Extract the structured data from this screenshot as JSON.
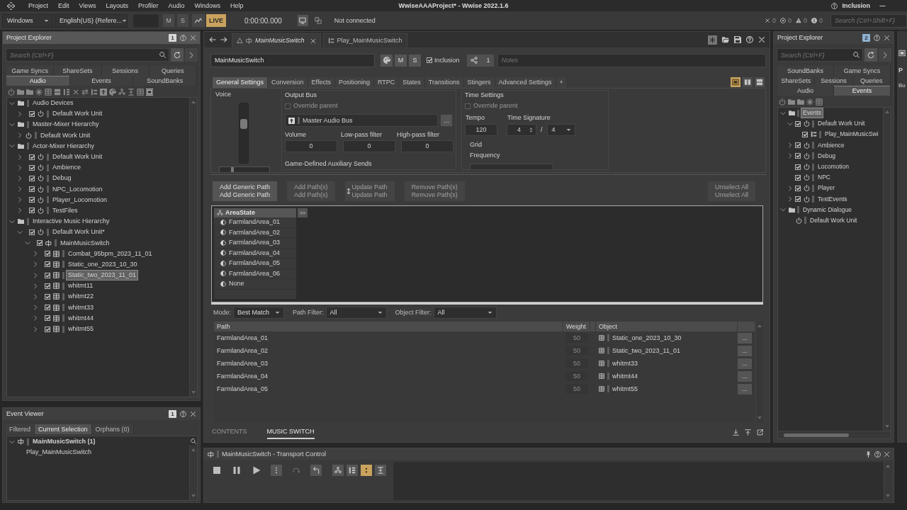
{
  "title_bar": {
    "menu": [
      "Project",
      "Edit",
      "Views",
      "Layouts",
      "Profiler",
      "Audio",
      "Windows",
      "Help"
    ],
    "title": "WwiseAAAProject* - Wwise 2022.1.6",
    "layout": "Inclusion"
  },
  "toolbar": {
    "layout_dropdown": "Windows",
    "language_dropdown": "English(US) (Refere...",
    "mute": "M",
    "solo": "S",
    "live": {
      "label": "LIVE",
      "on": true
    },
    "time": "0:00:00.000",
    "connection": "Not connected",
    "counters": [
      {
        "kind": "error",
        "count": "0"
      },
      {
        "kind": "critical",
        "count": "0"
      },
      {
        "kind": "warning",
        "count": "0"
      },
      {
        "kind": "info",
        "count": "0"
      }
    ],
    "search": {
      "placeholder": "Search (Ctrl+Shift+F)"
    }
  },
  "project_explorer": {
    "title": "Project Explorer",
    "badge": "1",
    "search": {
      "placeholder": "Search (Ctrl+F)"
    },
    "tab_rows": [
      [
        {
          "label": "Game Syncs",
          "selected": false
        },
        {
          "label": "ShareSets",
          "selected": false
        },
        {
          "label": "Sessions",
          "selected": false
        },
        {
          "label": "Queries",
          "selected": false
        }
      ],
      [
        {
          "label": "Audio",
          "selected": true
        },
        {
          "label": "Events",
          "selected": false
        },
        {
          "label": "SoundBanks",
          "selected": false
        }
      ]
    ],
    "toolbar": [
      {
        "on": false
      },
      {
        "on": false
      },
      {
        "on": false
      },
      {
        "on": false
      },
      {
        "on": false
      },
      {
        "on": false
      },
      {
        "on": false
      },
      {
        "on": false
      },
      {
        "on": false
      },
      {
        "on": false
      },
      {
        "on": false
      },
      {
        "on": false
      },
      {
        "on": false
      },
      {
        "on": false
      },
      {
        "on": false
      },
      {
        "on": true
      }
    ],
    "tree": [
      {
        "label": "Audio Devices",
        "kind": "folder",
        "expanded": true,
        "selected": false,
        "children": [
          {
            "label": "Default Work Unit",
            "kind": "work_unit",
            "expanded": false,
            "checked": true,
            "selected": false
          }
        ]
      },
      {
        "label": "Master-Mixer Hierarchy",
        "kind": "folder",
        "expanded": true,
        "selected": false,
        "children": [
          {
            "label": "Default Work Unit",
            "kind": "work_unit",
            "expanded": false,
            "selected": false
          }
        ]
      },
      {
        "label": "Actor-Mixer Hierarchy",
        "kind": "folder",
        "expanded": true,
        "selected": false,
        "children": [
          {
            "label": "Default Work Unit",
            "kind": "work_unit",
            "expanded": false,
            "checked": true,
            "selected": false
          },
          {
            "label": "Ambience",
            "kind": "work_unit",
            "expanded": false,
            "checked": true,
            "selected": false
          },
          {
            "label": "Debug",
            "kind": "work_unit",
            "expanded": false,
            "checked": true,
            "selected": false
          },
          {
            "label": "NPC_Locomotion",
            "kind": "work_unit",
            "expanded": false,
            "checked": true,
            "selected": false
          },
          {
            "label": "Player_Locomotion",
            "kind": "work_unit",
            "expanded": false,
            "checked": true,
            "selected": false
          },
          {
            "label": "TestFiles",
            "kind": "work_unit",
            "expanded": false,
            "checked": true,
            "selected": false
          }
        ]
      },
      {
        "label": "Interactive Music Hierarchy",
        "kind": "folder",
        "expanded": true,
        "selected": false,
        "children": [
          {
            "label": "Default Work Unit*",
            "kind": "work_unit",
            "expanded": true,
            "checked": true,
            "selected": false,
            "children": [
              {
                "label": "MainMusicSwitch",
                "kind": "switch",
                "expanded": true,
                "checked": true,
                "selected": false,
                "children": [
                  {
                    "label": "Combat_95bpm_2023_11_01",
                    "kind": "segment",
                    "expanded": false,
                    "checked": true,
                    "selected": false
                  },
                  {
                    "label": "Static_one_2023_10_30",
                    "kind": "segment",
                    "expanded": false,
                    "checked": true,
                    "selected": false
                  },
                  {
                    "label": "Static_two_2023_11_01",
                    "kind": "segment",
                    "expanded": false,
                    "checked": true,
                    "selected": true
                  },
                  {
                    "label": "whitmt11",
                    "kind": "segment",
                    "expanded": false,
                    "checked": true,
                    "selected": false
                  },
                  {
                    "label": "whitmt22",
                    "kind": "segment",
                    "expanded": false,
                    "checked": true,
                    "selected": false
                  },
                  {
                    "label": "whitmt33",
                    "kind": "segment",
                    "expanded": false,
                    "checked": true,
                    "selected": false
                  },
                  {
                    "label": "whitmt44",
                    "kind": "segment",
                    "expanded": false,
                    "checked": true,
                    "selected": false
                  },
                  {
                    "label": "whitmt55",
                    "kind": "segment",
                    "expanded": false,
                    "checked": true,
                    "selected": false
                  }
                ]
              }
            ]
          }
        ]
      }
    ]
  },
  "event_viewer": {
    "title": "Event Viewer",
    "badge": "1",
    "tabs": [
      {
        "label": "Filtered",
        "selected": false
      },
      {
        "label": "Current Selection",
        "selected": true
      },
      {
        "label": "Orphans (0)",
        "selected": false
      }
    ],
    "tree": [
      {
        "label": "MainMusicSwitch (1)",
        "kind": "switch",
        "expanded": true,
        "selected": false,
        "children": [
          {
            "label": "Play_MainMusicSwitch",
            "selected": false
          }
        ]
      }
    ]
  },
  "editor": {
    "doc_tabs": [
      {
        "label": "MainMusicSwitch",
        "kind": "switch",
        "selected": true
      },
      {
        "label": "Play_MainMusicSwitch",
        "kind": "event",
        "selected": false
      }
    ],
    "name": "MainMusicSwitch",
    "mute": "M",
    "solo": "S",
    "inclusion": {
      "label": "Inclusion",
      "checked": true
    },
    "references": "1",
    "notes": {
      "placeholder": "Notes"
    },
    "property_tabs": [
      {
        "label": "General Settings",
        "selected": true
      },
      {
        "label": "Conversion",
        "selected": false
      },
      {
        "label": "Effects",
        "selected": false
      },
      {
        "label": "Positioning",
        "selected": false
      },
      {
        "label": "RTPC",
        "selected": false
      },
      {
        "label": "States",
        "selected": false
      },
      {
        "label": "Transitions",
        "selected": false
      },
      {
        "label": "Stingers",
        "selected": false
      },
      {
        "label": "Advanced Settings",
        "selected": false
      }
    ],
    "add_tab": "+",
    "layout_buttons": [
      {
        "kind": "single",
        "selected": true
      },
      {
        "kind": "columns",
        "selected": false
      },
      {
        "kind": "rows",
        "selected": false
      }
    ],
    "voice": {
      "label": "Voice",
      "vertical_slider": {
        "level": 0.65
      },
      "horizontal_slider": {
        "level": 0.25
      }
    },
    "output_bus": {
      "title": "Output Bus",
      "override": {
        "label": "Override parent",
        "checked": false,
        "disabled": true
      },
      "bus": "Master Audio Bus",
      "browse": "...",
      "fields": [
        {
          "label": "Volume",
          "value": "0"
        },
        {
          "label": "Low-pass filter",
          "value": "0"
        },
        {
          "label": "High-pass filter",
          "value": "0"
        }
      ],
      "aux_sends": "Game-Defined Auxiliary Sends"
    },
    "time_settings": {
      "title": "Time Settings",
      "override": {
        "label": "Override parent",
        "checked": false,
        "disabled": true
      },
      "tempo": {
        "label": "Tempo",
        "value": "120"
      },
      "time_signature": {
        "label": "Time Signature",
        "beats": "4",
        "separator": "/",
        "unit": "4"
      },
      "grid": "Grid",
      "frequency": "Frequency"
    },
    "path_buttons": [
      {
        "lines": [
          "Add Generic Path",
          "Add Generic Path"
        ],
        "disabled": false,
        "hovered": false
      },
      {
        "lines": [
          "Add Path(s)",
          "Add Path(s)"
        ],
        "disabled": true,
        "hovered": false
      },
      {
        "lines": [
          "Update Path",
          "Update Path"
        ],
        "disabled": true,
        "hovered": true
      },
      {
        "lines": [
          "Remove Path(s)",
          "Remove Path(s)"
        ],
        "disabled": true,
        "hovered": false
      }
    ],
    "unselect": {
      "lines": [
        "Unselect All",
        "Unselect All"
      ],
      "disabled": true
    },
    "state_group": {
      "name": "AreaState",
      "expand": ">>",
      "states": [
        "FarmlandArea_01",
        "FarmlandArea_02",
        "FarmlandArea_03",
        "FarmlandArea_04",
        "FarmlandArea_05",
        "FarmlandArea_06",
        "None"
      ]
    },
    "filters": [
      {
        "label": "Mode:",
        "value": "Best Match"
      },
      {
        "label": "Path Filter:",
        "value": "All"
      },
      {
        "label": "Object Filter:",
        "value": "All"
      }
    ],
    "paths_table": {
      "columns": [
        "Path",
        "Weight",
        "Object"
      ],
      "rows": [
        {
          "path": "FarmlandArea_01",
          "weight": "50",
          "object": "Static_one_2023_10_30",
          "browse": "..."
        },
        {
          "path": "FarmlandArea_02",
          "weight": "50",
          "object": "Static_two_2023_11_01",
          "browse": "..."
        },
        {
          "path": "FarmlandArea_03",
          "weight": "50",
          "object": "whitmt33",
          "browse": "..."
        },
        {
          "path": "FarmlandArea_04",
          "weight": "50",
          "object": "whitmt44",
          "browse": "..."
        },
        {
          "path": "FarmlandArea_05",
          "weight": "50",
          "object": "whitmt55",
          "browse": "..."
        }
      ]
    },
    "bottom_tabs": [
      {
        "label": "CONTENTS",
        "selected": false
      },
      {
        "label": "MUSIC SWITCH",
        "selected": true
      }
    ]
  },
  "transport": {
    "title": "MainMusicSwitch - Transport Control",
    "buttons": [
      {
        "disabled": false
      },
      {
        "disabled": false
      },
      {
        "disabled": false
      },
      {
        "disabled": false
      },
      {
        "disabled": true
      },
      {
        "disabled": false
      }
    ],
    "toggles": [
      {
        "on": false
      },
      {
        "on": false
      },
      {
        "on": true
      },
      {
        "on": false
      }
    ]
  },
  "project_explorer_2": {
    "title": "Project Explorer",
    "badge": "2",
    "search": {
      "placeholder": "Search (Ctrl+F)"
    },
    "tab_rows": [
      [
        {
          "label": "SoundBanks",
          "selected": false
        },
        {
          "label": "Game Syncs",
          "selected": false
        }
      ],
      [
        {
          "label": "ShareSets",
          "selected": false
        },
        {
          "label": "Sessions",
          "selected": false
        },
        {
          "label": "Queries",
          "selected": false
        }
      ],
      [
        {
          "label": "Audio",
          "selected": false
        },
        {
          "label": "Events",
          "selected": true
        }
      ]
    ],
    "tree": [
      {
        "label": "Events",
        "kind": "folder",
        "expanded": true,
        "selected": true,
        "children": [
          {
            "label": "Default Work Unit",
            "kind": "work_unit",
            "expanded": true,
            "checked": true,
            "selected": false,
            "children": [
              {
                "label": "Play_MainMusicSwi",
                "kind": "event",
                "checked": true,
                "selected": false
              }
            ]
          },
          {
            "label": "Ambience",
            "kind": "work_unit",
            "expanded": false,
            "checked": true,
            "selected": false
          },
          {
            "label": "Debug",
            "kind": "work_unit",
            "expanded": false,
            "checked": true,
            "selected": false
          },
          {
            "label": "Locomotion",
            "kind": "work_unit",
            "checked": true,
            "selected": false
          },
          {
            "label": "NPC",
            "kind": "work_unit",
            "checked": true,
            "selected": false
          },
          {
            "label": "Player",
            "kind": "work_unit",
            "expanded": false,
            "checked": true,
            "selected": false
          },
          {
            "label": "TestEvents",
            "kind": "work_unit",
            "expanded": false,
            "checked": true,
            "selected": false
          }
        ]
      },
      {
        "label": "Dynamic Dialogue",
        "kind": "folder",
        "expanded": true,
        "selected": false,
        "children": [
          {
            "label": "Default Work Unit",
            "kind": "work_unit",
            "selected": false
          }
        ]
      }
    ]
  },
  "strip": {
    "header": "P",
    "label": "Bu"
  }
}
